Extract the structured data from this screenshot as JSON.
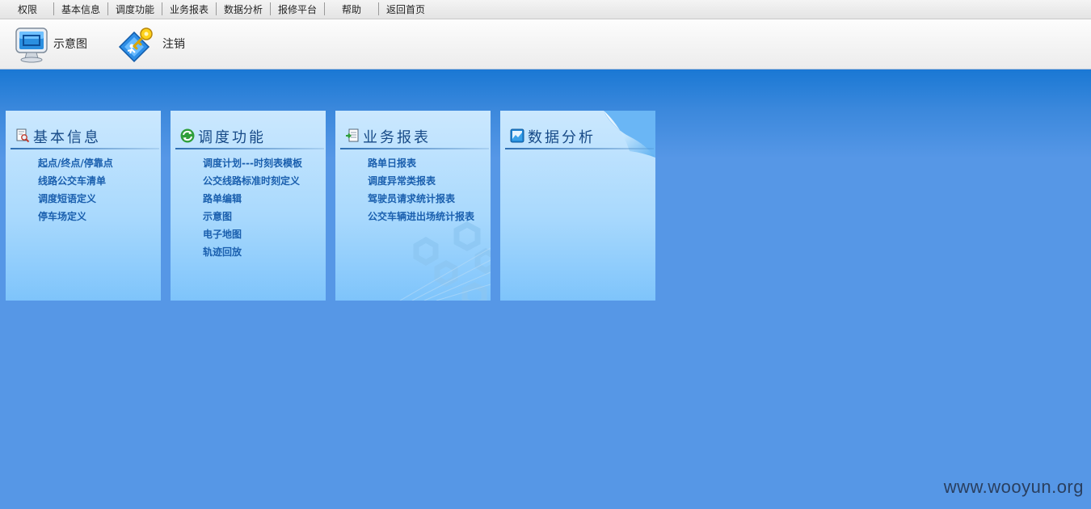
{
  "menu": {
    "items": [
      "权限",
      "基本信息",
      "调度功能",
      "业务报表",
      "数据分析",
      "报修平台",
      "帮助",
      "返回首页"
    ]
  },
  "toolbar": {
    "schematic_label": "示意图",
    "logout_label": "注销"
  },
  "panels": [
    {
      "title": "基本信息",
      "icon": "document-search-icon",
      "links": [
        "起点/终点/停靠点",
        "线路公交车清单",
        "调度短语定义",
        "停车场定义"
      ]
    },
    {
      "title": "调度功能",
      "icon": "refresh-icon",
      "links": [
        "调度计划---时刻表模板",
        "公交线路标准时刻定义",
        "路单编辑",
        "示意图",
        "电子地图",
        "轨迹回放"
      ]
    },
    {
      "title": "业务报表",
      "icon": "report-icon",
      "links": [
        "路单日报表",
        "调度异常类报表",
        "驾驶员请求统计报表",
        "公交车辆进出场统计报表"
      ]
    },
    {
      "title": "数据分析",
      "icon": "chart-icon",
      "links": []
    }
  ],
  "watermark": "www.wooyun.org",
  "colors": {
    "background": "#5697e6",
    "band_top": "#1a78d4",
    "panel_title": "#174a87",
    "panel_link": "#1a5fae"
  }
}
